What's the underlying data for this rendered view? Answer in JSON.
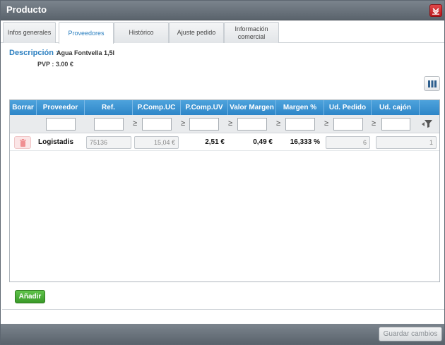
{
  "window": {
    "title": "Producto"
  },
  "tabs": [
    {
      "label": "Infos generales",
      "active": false
    },
    {
      "label": "Proveedores",
      "active": true
    },
    {
      "label": "Histórico",
      "active": false
    },
    {
      "label": "Ajuste pedido",
      "active": false
    },
    {
      "label": "Información comercial",
      "active": false
    }
  ],
  "product": {
    "desc_label": "Descripción :",
    "desc_value": "Agua Fontvella 1,5l",
    "pvp_label": "PVP :",
    "pvp_value": "3.00 €"
  },
  "grid": {
    "headers": [
      "Borrar",
      "Proveedor",
      "Ref.",
      "P.Comp.UC",
      "P.Comp.UV",
      "Valor Margen",
      "Margen %",
      "Ud. Pedido",
      "Ud. cajón"
    ],
    "filter_symbol": "≥",
    "rows": [
      {
        "proveedor": "Logistadis",
        "ref": "75136",
        "p_comp_uc": "15,04 €",
        "p_comp_uv": "2,51 €",
        "valor_margen": "0,49 €",
        "margen_pct": "16,333 %",
        "ud_pedido": "6",
        "ud_cajon": "1"
      }
    ]
  },
  "buttons": {
    "add": "Añadir",
    "save": "Guardar cambios"
  },
  "colors": {
    "accent": "#2b7fc0",
    "header_blue": "#3a92d2",
    "add_green": "#48ad33",
    "close_red": "#d22a2e"
  },
  "icons": {
    "close": "close-icon",
    "columns": "columns-icon",
    "trash": "trash-icon",
    "filter": "filter-icon"
  }
}
